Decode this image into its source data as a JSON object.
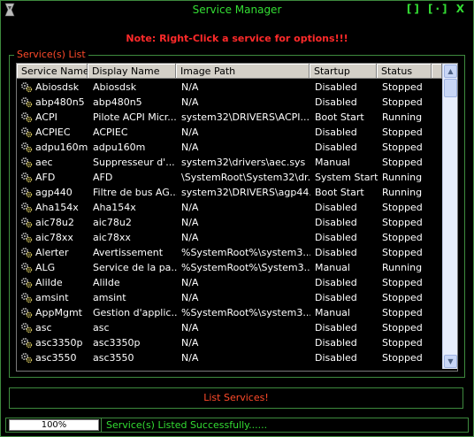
{
  "window": {
    "title": "Service Manager",
    "buttons": [
      "[]",
      "[·]",
      "X"
    ],
    "note": "Note: Right-Click a service for options!!!"
  },
  "group": {
    "legend": "Service(s) List"
  },
  "columns": [
    "Service Name",
    "Display Name",
    "Image Path",
    "Startup",
    "Status"
  ],
  "services": [
    [
      "Abiosdsk",
      "Abiosdsk",
      "N/A",
      "Disabled",
      "Stopped"
    ],
    [
      "abp480n5",
      "abp480n5",
      "N/A",
      "Disabled",
      "Stopped"
    ],
    [
      "ACPI",
      "Pilote ACPI Micr...",
      "system32\\DRIVERS\\ACPI....",
      "Boot Start",
      "Running"
    ],
    [
      "ACPIEC",
      "ACPIEC",
      "N/A",
      "Disabled",
      "Stopped"
    ],
    [
      "adpu160m",
      "adpu160m",
      "N/A",
      "Disabled",
      "Stopped"
    ],
    [
      "aec",
      "Suppresseur d'...",
      "system32\\drivers\\aec.sys",
      "Manual",
      "Stopped"
    ],
    [
      "AFD",
      "AFD",
      "\\SystemRoot\\System32\\dr...",
      "System Start",
      "Running"
    ],
    [
      "agp440",
      "Filtre de bus AG...",
      "system32\\DRIVERS\\agp44...",
      "Boot Start",
      "Running"
    ],
    [
      "Aha154x",
      "Aha154x",
      "N/A",
      "Disabled",
      "Stopped"
    ],
    [
      "aic78u2",
      "aic78u2",
      "N/A",
      "Disabled",
      "Stopped"
    ],
    [
      "aic78xx",
      "aic78xx",
      "N/A",
      "Disabled",
      "Stopped"
    ],
    [
      "Alerter",
      "Avertissement",
      "%SystemRoot%\\system3...",
      "Disabled",
      "Stopped"
    ],
    [
      "ALG",
      "Service de la pa...",
      "%SystemRoot%\\System3...",
      "Manual",
      "Running"
    ],
    [
      "AliIde",
      "AliIde",
      "N/A",
      "Disabled",
      "Stopped"
    ],
    [
      "amsint",
      "amsint",
      "N/A",
      "Disabled",
      "Stopped"
    ],
    [
      "AppMgmt",
      "Gestion d'applic...",
      "%SystemRoot%\\system3...",
      "Manual",
      "Stopped"
    ],
    [
      "asc",
      "asc",
      "N/A",
      "Disabled",
      "Stopped"
    ],
    [
      "asc3350p",
      "asc3350p",
      "N/A",
      "Disabled",
      "Stopped"
    ],
    [
      "asc3550",
      "asc3550",
      "N/A",
      "Disabled",
      "Stopped"
    ]
  ],
  "actions": {
    "list_services": "List Services!"
  },
  "status": {
    "progress_label": "100%",
    "progress_value": 1.0,
    "message": "Service(s) Listed Successfully......"
  },
  "colors": {
    "accent_green": "#33dd33",
    "note_red": "#ff2a2a",
    "label_orange": "#ff4a2a",
    "border_green": "#3e8a3e"
  }
}
